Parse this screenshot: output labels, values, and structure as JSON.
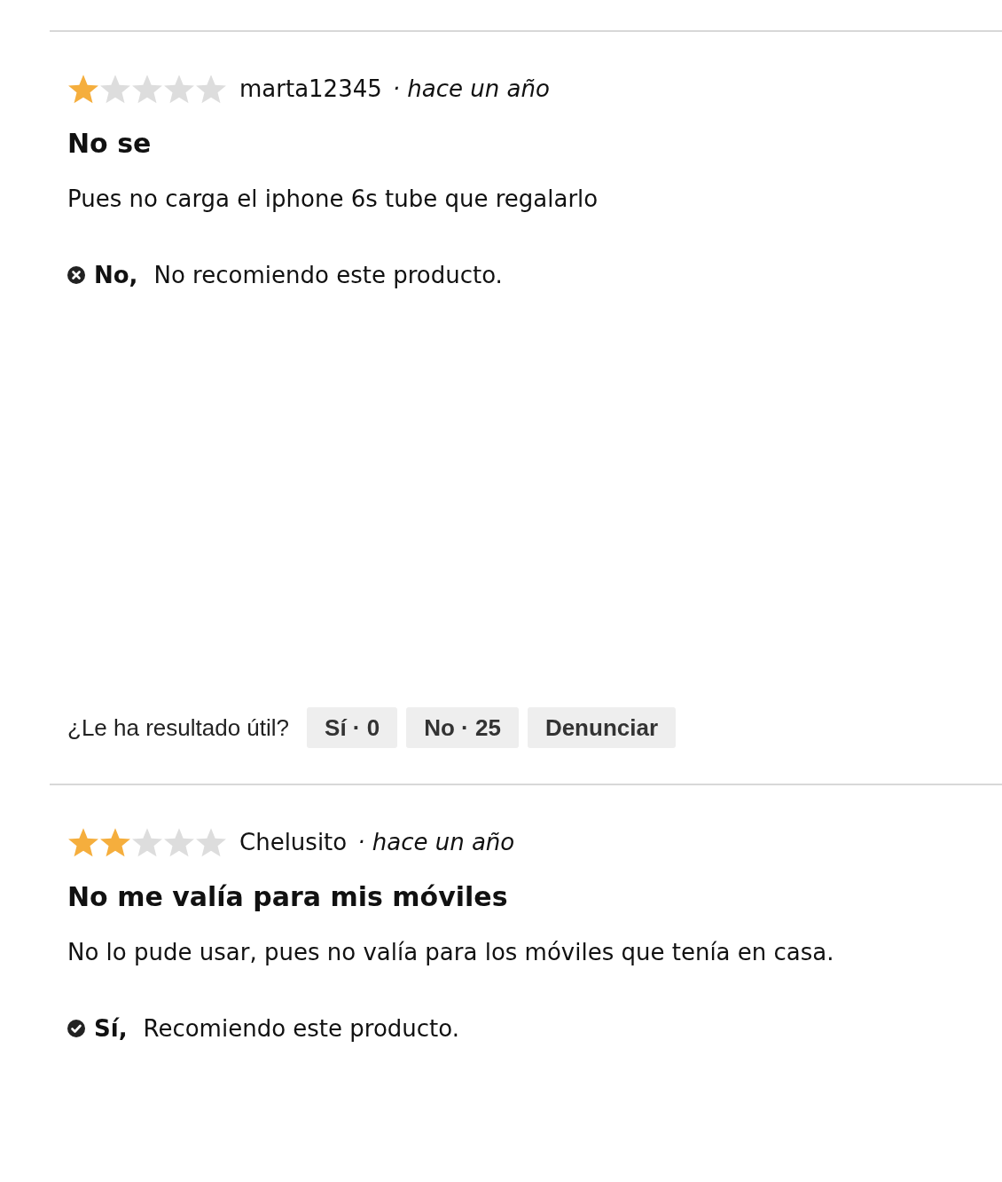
{
  "reviews": [
    {
      "stars": 1,
      "author": "marta12345",
      "date": "· hace un año",
      "title": "No se",
      "body": "Pues no carga el iphone 6s tube que regalarlo",
      "recommendation": {
        "recommended": false,
        "answer": "No,",
        "text": "No recomiendo este producto."
      },
      "helpful": {
        "question": "¿Le ha resultado útil?",
        "buttons": [
          "Sí · 0",
          "No · 25",
          "Denunciar"
        ]
      }
    },
    {
      "stars": 2,
      "author": "Chelusito",
      "date": "· hace un año",
      "title": "No me valía para mis móviles",
      "body": "No lo pude usar, pues no valía para los móviles que tenía en casa.",
      "recommendation": {
        "recommended": true,
        "answer": "Sí,",
        "text": "Recomiendo este producto."
      }
    }
  ]
}
